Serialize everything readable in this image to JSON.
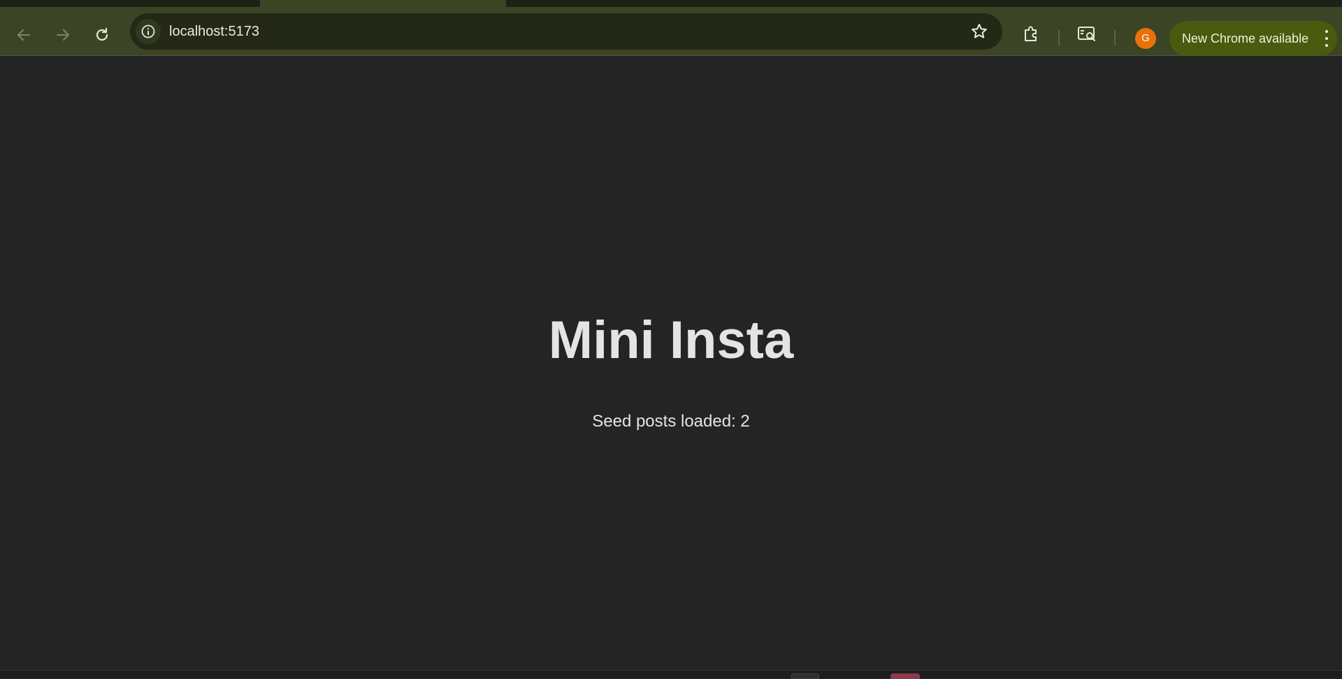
{
  "browser": {
    "url": "localhost:5173",
    "profile_initial": "G",
    "update_label": "New Chrome available",
    "icons": {
      "back": "arrow-left-icon",
      "forward": "arrow-right-icon",
      "reload": "reload-icon",
      "site_info": "info-icon",
      "bookmark": "star-icon",
      "extensions": "puzzle-icon",
      "reading_mode": "reading-mode-icon",
      "menu": "kebab-menu-icon"
    },
    "colors": {
      "toolbar": "#3b4526",
      "omnibox": "#242816",
      "avatar": "#e8710a",
      "update_pill": "#4a5a0e"
    }
  },
  "page": {
    "title": "Mini Insta",
    "subtitle": "Seed posts loaded: 2",
    "background": "#242424"
  }
}
